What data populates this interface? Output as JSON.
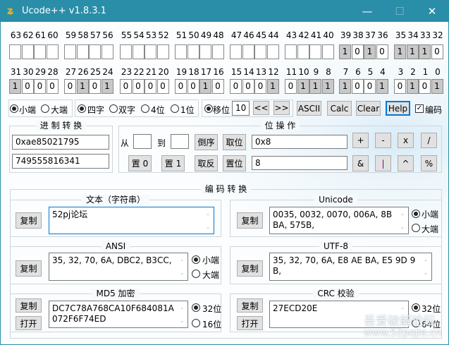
{
  "window": {
    "title": "Ucode++  v1.8.3.1",
    "minimize": "—",
    "maximize": "☐",
    "close": "✕"
  },
  "bits": {
    "top_labels": [
      [
        "63",
        "62",
        "61",
        "60"
      ],
      [
        "59",
        "58",
        "57",
        "56"
      ],
      [
        "55",
        "54",
        "53",
        "52"
      ],
      [
        "51",
        "50",
        "49",
        "48"
      ],
      [
        "47",
        "46",
        "45",
        "44"
      ],
      [
        "43",
        "42",
        "41",
        "40"
      ],
      [
        "39",
        "38",
        "37",
        "36"
      ],
      [
        "35",
        "34",
        "33",
        "32"
      ]
    ],
    "top_values": [
      [
        "",
        "",
        "",
        ""
      ],
      [
        "",
        "",
        "",
        ""
      ],
      [
        "",
        "",
        "",
        ""
      ],
      [
        "",
        "",
        "",
        ""
      ],
      [
        "",
        "",
        "",
        ""
      ],
      [
        "",
        "",
        "",
        ""
      ],
      [
        "1",
        "0",
        "1",
        "0"
      ],
      [
        "1",
        "1",
        "1",
        "0"
      ]
    ],
    "bottom_labels": [
      [
        "31",
        "30",
        "29",
        "28"
      ],
      [
        "27",
        "26",
        "25",
        "24"
      ],
      [
        "23",
        "22",
        "21",
        "20"
      ],
      [
        "19",
        "18",
        "17",
        "16"
      ],
      [
        "15",
        "14",
        "13",
        "12"
      ],
      [
        "11",
        "10",
        "9",
        "8"
      ],
      [
        "7",
        "6",
        "5",
        "4"
      ],
      [
        "3",
        "2",
        "1",
        "0"
      ]
    ],
    "bottom_values": [
      [
        "1",
        "0",
        "0",
        "0"
      ],
      [
        "0",
        "1",
        "0",
        "1"
      ],
      [
        "0",
        "0",
        "0",
        "0"
      ],
      [
        "0",
        "0",
        "1",
        "0"
      ],
      [
        "0",
        "0",
        "0",
        "1"
      ],
      [
        "0",
        "1",
        "1",
        "1"
      ],
      [
        "1",
        "0",
        "0",
        "1"
      ],
      [
        "0",
        "1",
        "0",
        "1"
      ]
    ]
  },
  "options": {
    "little_endian": "小端",
    "big_endian": "大端",
    "four_byte": "四字",
    "two_byte": "双字",
    "four_bit": "4位",
    "one_bit": "1位",
    "shift": "移位",
    "shift_value": "10",
    "shift_left": "<<",
    "shift_right": ">>",
    "ascii": "ASCII",
    "calc": "Calc",
    "clear": "Clear",
    "help": "Help",
    "encode": "编码",
    "encode_checked": true
  },
  "radix": {
    "title": "进 制 转 换",
    "hex": "0xae85021795",
    "dec": "749555816341"
  },
  "bitops": {
    "title": "位 操 作",
    "from": "从",
    "to": "到",
    "from_value": "",
    "to_value": "",
    "reverse": "倒序",
    "take_bits": "取位",
    "set0": "置 0",
    "set1": "置 1",
    "invert": "取反",
    "set_bit": "置位",
    "hex_value": "0x8",
    "dec_value": "8",
    "ops": [
      "+",
      "-",
      "x",
      "/",
      "&",
      "|",
      "^",
      "%"
    ]
  },
  "encoding": {
    "title": "编 码 转 换",
    "copy": "复制",
    "open": "打开",
    "text": {
      "title": "文本（字符串）",
      "value": "52pj论坛"
    },
    "unicode": {
      "title": "Unicode",
      "value": "0035, 0032, 0070, 006A, 8BBA, 575B,",
      "r1": "小端",
      "r2": "大端"
    },
    "ansi": {
      "title": "ANSI",
      "value": "35, 32, 70, 6A, DBC2, B3CC,",
      "r1": "小端",
      "r2": "大端"
    },
    "utf8": {
      "title": "UTF-8",
      "value": "35, 32, 70, 6A, E8 AE BA, E5 9D 9B,"
    },
    "md5": {
      "title": "MD5 加密",
      "value": "DC7C78A768CA10F684081A072F6F74ED",
      "r1": "32位",
      "r2": "16位"
    },
    "crc": {
      "title": "CRC 校验",
      "value": "27ECD20E",
      "r1": "32位",
      "r2": "64位"
    }
  },
  "watermark": {
    "line1": "吾爱破解论坛",
    "line2": "www.52pojie.cn"
  }
}
